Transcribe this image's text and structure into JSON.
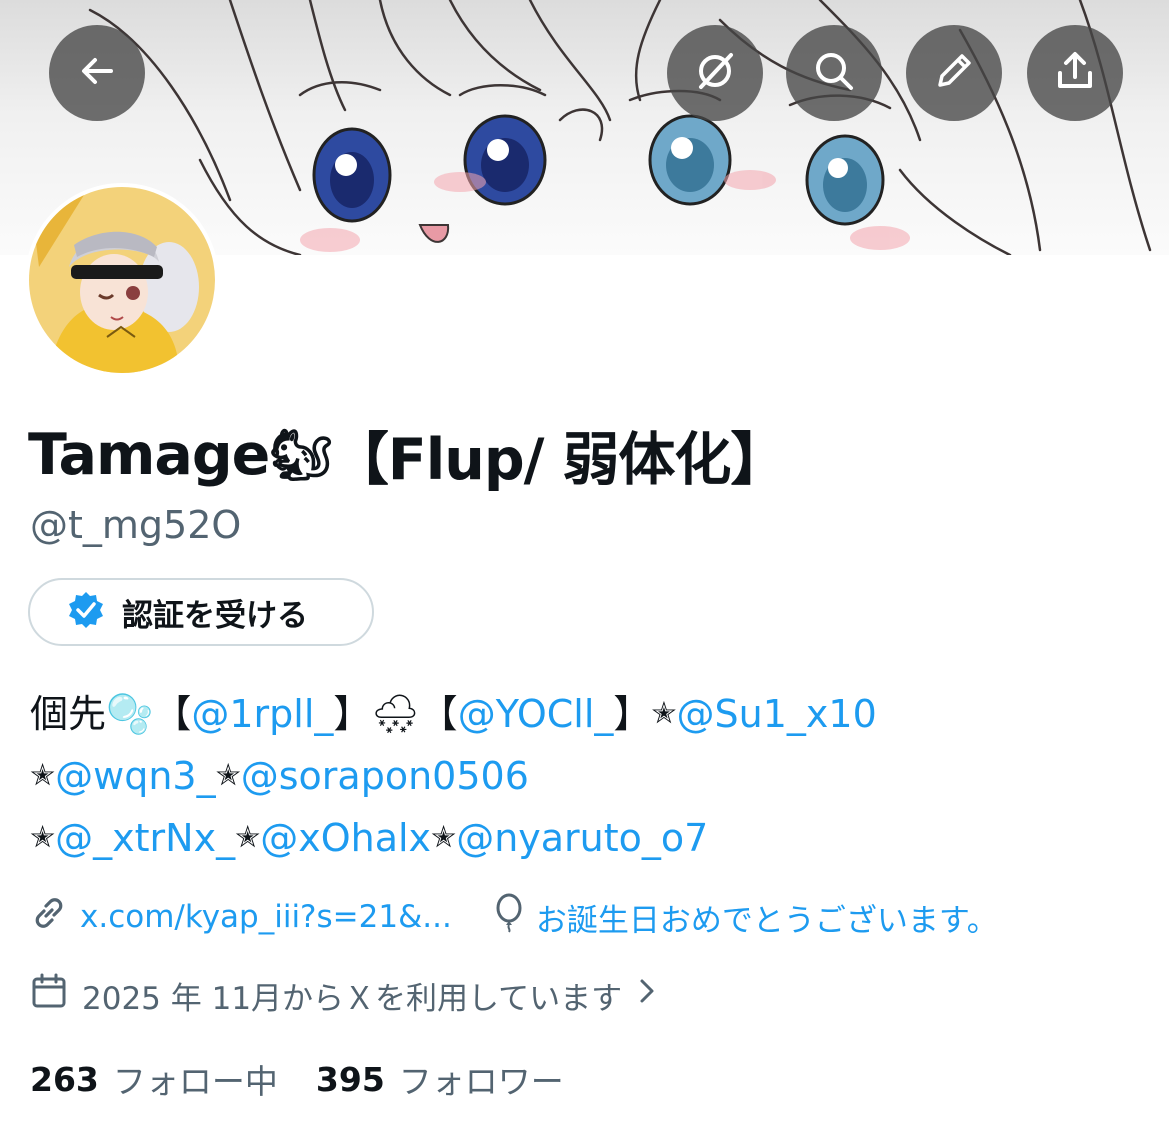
{
  "header": {
    "back_icon": "arrow-left-icon",
    "grok_icon": "grok-icon",
    "search_icon": "search-icon",
    "edit_icon": "pencil-icon",
    "share_icon": "share-icon"
  },
  "profile": {
    "name": "Tamage",
    "name_emoji": "🐿",
    "name_suffix": "【Flup/ 弱体化】",
    "handle": "@t_mg52O",
    "verify_label": "認証を受ける"
  },
  "bio": {
    "line1": [
      {
        "t": "個先",
        "c": "text"
      },
      {
        "t": "🫧",
        "c": "emoji"
      },
      {
        "t": "【",
        "c": "text"
      },
      {
        "t": "@1rpll_",
        "c": "mention"
      },
      {
        "t": "】",
        "c": "text"
      },
      {
        "t": "🌨",
        "c": "emoji"
      },
      {
        "t": "【",
        "c": "text"
      },
      {
        "t": "@YOCll_",
        "c": "mention"
      },
      {
        "t": "】",
        "c": "text"
      },
      {
        "t": "✭",
        "c": "star"
      },
      {
        "t": "@Su1_x10",
        "c": "mention"
      }
    ],
    "line2": [
      {
        "t": "✭",
        "c": "star"
      },
      {
        "t": "@wqn3_",
        "c": "mention"
      },
      {
        "t": " ",
        "c": "text"
      },
      {
        "t": "✭",
        "c": "star"
      },
      {
        "t": "@sorapon0506",
        "c": "mention"
      }
    ],
    "line3": [
      {
        "t": "✭",
        "c": "star"
      },
      {
        "t": "@_xtrNx_",
        "c": "mention"
      },
      {
        "t": "✭",
        "c": "star"
      },
      {
        "t": "@xOhalx",
        "c": "mention"
      },
      {
        "t": "✭",
        "c": "star"
      },
      {
        "t": "@nyaruto_o7",
        "c": "mention"
      }
    ]
  },
  "meta": {
    "link_text": "x.com/kyap_iii?s=21&...",
    "birthday_text": "お誕生日おめでとうございます。",
    "joined_text": "2025 年 11月からＸを利用しています"
  },
  "stats": {
    "following_count": "263",
    "following_label": "フォロー中",
    "followers_count": "395",
    "followers_label": "フォロワー"
  },
  "colors": {
    "accent": "#1d9bf0",
    "secondary_text": "#536471",
    "primary_text": "#0f1419",
    "border": "#cfd9de"
  }
}
